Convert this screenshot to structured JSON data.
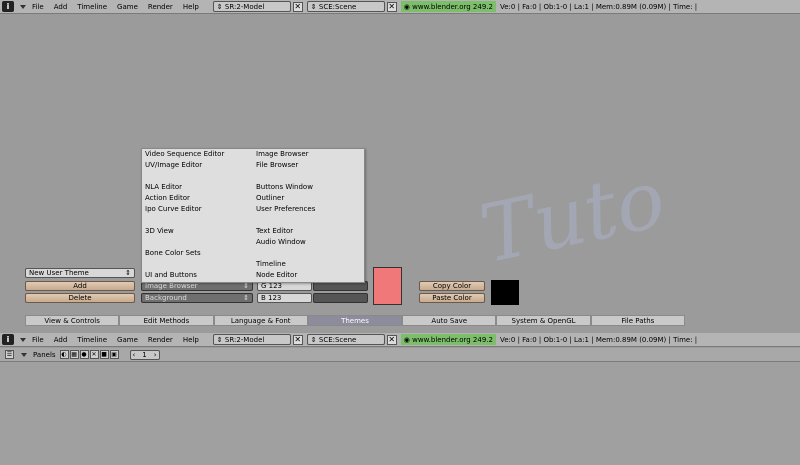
{
  "header": {
    "menus": [
      "File",
      "Add",
      "Timeline",
      "Game",
      "Render",
      "Help"
    ],
    "screen": "SR:2-Model",
    "scene": "SCE:Scene",
    "url": "www.blender.org 249.2",
    "stats": "Ve:0 | Fa:0 | Ob:1-0 | La:1  | Mem:0.89M (0.09M)  | Time: |"
  },
  "prefs": {
    "theme_select": "New User Theme",
    "add_label": "Add",
    "delete_label": "Delete",
    "category_select": "Background",
    "g_value": "G 123",
    "b_value": "B 123",
    "copy_color": "Copy Color",
    "paste_color": "Paste Color",
    "colors": {
      "swatch": "#f07878",
      "black": "#000000"
    }
  },
  "popup": {
    "left": [
      "Video Sequence Editor",
      "UV/Image Editor",
      "",
      "NLA Editor",
      "Action Editor",
      "Ipo Curve Editor",
      "",
      "3D View",
      "",
      "Bone Color Sets",
      "",
      "UI and Buttons",
      "Image Browser"
    ],
    "right": [
      "Image Browser",
      "File Browser",
      "",
      "Buttons Window",
      "Outliner",
      "User Preferences",
      "",
      "Text Editor",
      "Audio Window",
      "",
      "Timeline",
      "Node Editor"
    ]
  },
  "tabs": [
    "View & Controls",
    "Edit Methods",
    "Language & Font",
    "Themes",
    "Auto Save",
    "System & OpenGL",
    "File Paths"
  ],
  "active_tab": "Themes",
  "panels": {
    "label": "Panels",
    "page": "1"
  },
  "watermark": "Tuto"
}
